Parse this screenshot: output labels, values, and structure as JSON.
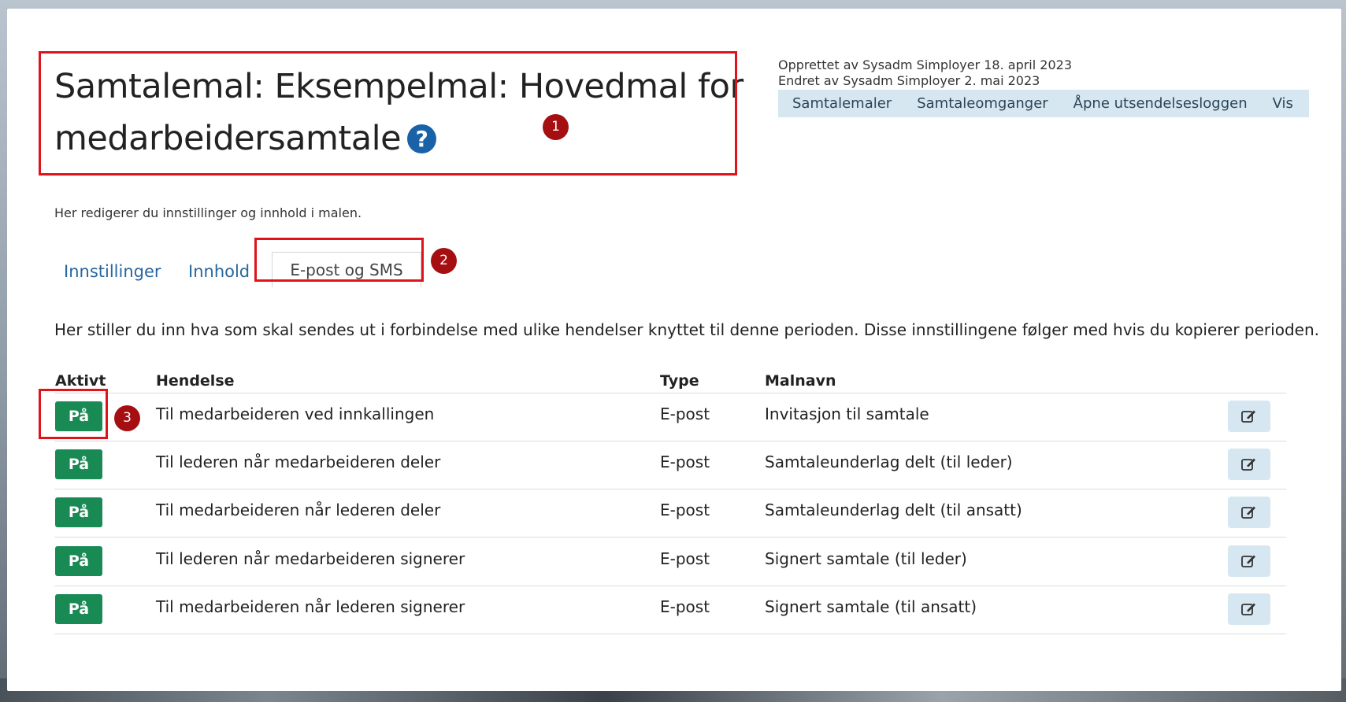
{
  "header": {
    "title": "Samtalemal: Eksempelmal: Hovedmal for medarbeidersamtale",
    "help_icon": "question-circle-icon",
    "created": "Opprettet av Sysadm Simployer  18. april 2023",
    "modified": "Endret av Sysadm Simployer  2. mai 2023",
    "subtitle": "Her redigerer du innstillinger og innhold i malen."
  },
  "topnav": [
    "Samtalemaler",
    "Samtaleomganger",
    "Åpne utsendelsesloggen",
    "Vis"
  ],
  "tabs": [
    "Innstillinger",
    "Innhold",
    "E-post og SMS"
  ],
  "intro": "Her stiller du inn hva som skal sendes ut i forbindelse med ulike hendelser knyttet til denne perioden. Disse innstillingene følger med hvis du kopierer perioden.",
  "table": {
    "headers": [
      "Aktivt",
      "Hendelse",
      "Type",
      "Malnavn"
    ],
    "rows": [
      {
        "active": "På",
        "event": "Til medarbeideren ved innkallingen",
        "type": "E-post",
        "template": "Invitasjon til samtale"
      },
      {
        "active": "På",
        "event": "Til lederen når medarbeideren deler",
        "type": "E-post",
        "template": "Samtaleunderlag delt (til leder)"
      },
      {
        "active": "På",
        "event": "Til medarbeideren når lederen deler",
        "type": "E-post",
        "template": "Samtaleunderlag delt (til ansatt)"
      },
      {
        "active": "På",
        "event": "Til lederen når medarbeideren signerer",
        "type": "E-post",
        "template": "Signert samtale (til leder)"
      },
      {
        "active": "På",
        "event": "Til medarbeideren når lederen signerer",
        "type": "E-post",
        "template": "Signert samtale (til ansatt)"
      }
    ]
  },
  "markers": [
    "1",
    "2",
    "3"
  ],
  "colors": {
    "accent_button": "#1a8a55",
    "annotation": "#e0131a",
    "marker": "#a50f12",
    "link": "#27669e"
  }
}
